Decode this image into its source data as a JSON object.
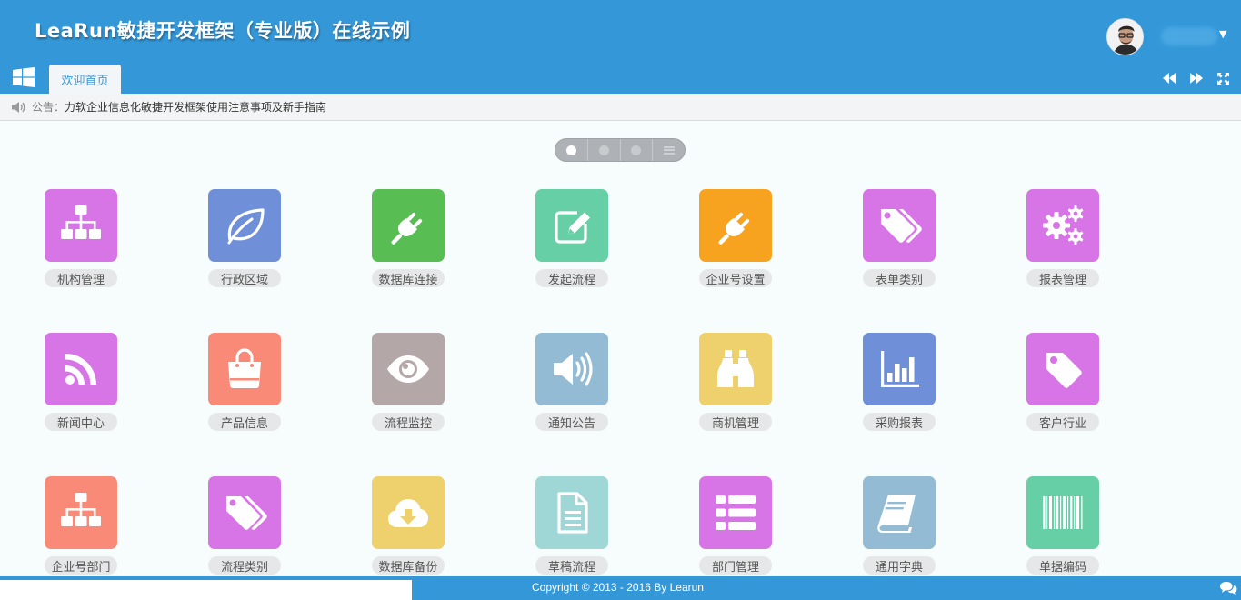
{
  "header": {
    "title": "LeaRun敏捷开发框架（专业版）在线示例",
    "tabs": [
      {
        "label": "欢迎首页"
      }
    ]
  },
  "notice": {
    "label": "公告：",
    "text": "力软企业信息化敏捷开发框架使用注意事项及新手指南"
  },
  "pager": {
    "pages": 3,
    "active": 1
  },
  "tiles": [
    {
      "label": "机构管理",
      "color": "#d774e6",
      "icon": "org-chart-icon"
    },
    {
      "label": "行政区域",
      "color": "#6f8fd9",
      "icon": "leaf-icon"
    },
    {
      "label": "数据库连接",
      "color": "#58bd53",
      "icon": "plug-icon"
    },
    {
      "label": "发起流程",
      "color": "#66cfa6",
      "icon": "edit-icon"
    },
    {
      "label": "企业号设置",
      "color": "#f7a31f",
      "icon": "plug-icon"
    },
    {
      "label": "表单类别",
      "color": "#d774e6",
      "icon": "tags-icon"
    },
    {
      "label": "报表管理",
      "color": "#d774e6",
      "icon": "gears-icon"
    },
    {
      "label": "新闻中心",
      "color": "#d774e6",
      "icon": "rss-icon"
    },
    {
      "label": "产品信息",
      "color": "#f98a78",
      "icon": "shopping-bag-icon"
    },
    {
      "label": "流程监控",
      "color": "#b4a7a8",
      "icon": "eye-icon"
    },
    {
      "label": "通知公告",
      "color": "#93bcd4",
      "icon": "volume-icon"
    },
    {
      "label": "商机管理",
      "color": "#eed16d",
      "icon": "binoculars-icon"
    },
    {
      "label": "采购报表",
      "color": "#6f8fd9",
      "icon": "bar-chart-icon"
    },
    {
      "label": "客户行业",
      "color": "#d774e6",
      "icon": "tag-icon"
    },
    {
      "label": "企业号部门",
      "color": "#f98a78",
      "icon": "org-chart-icon"
    },
    {
      "label": "流程类别",
      "color": "#d774e6",
      "icon": "tags-icon"
    },
    {
      "label": "数据库备份",
      "color": "#eed16d",
      "icon": "cloud-download-icon"
    },
    {
      "label": "草稿流程",
      "color": "#9fd7d7",
      "icon": "file-text-icon"
    },
    {
      "label": "部门管理",
      "color": "#d774e6",
      "icon": "th-list-icon"
    },
    {
      "label": "通用字典",
      "color": "#93bcd4",
      "icon": "book-icon"
    },
    {
      "label": "单据编码",
      "color": "#66cfa6",
      "icon": "barcode-icon"
    }
  ],
  "footer": {
    "copyright": "Copyright © 2013 - 2016 By Learun"
  }
}
